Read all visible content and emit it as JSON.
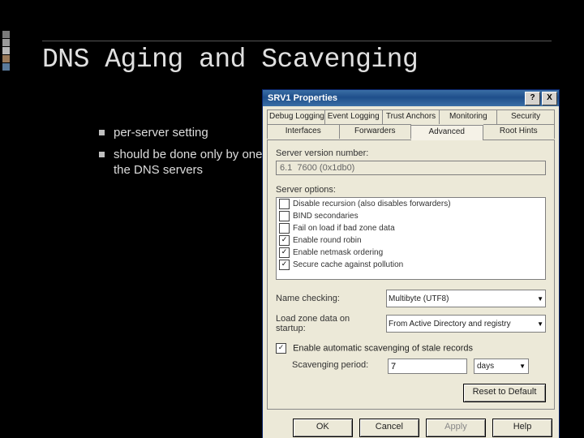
{
  "slide": {
    "title": "DNS Aging and Scavenging",
    "bullets": [
      "per-server setting",
      "should be done only by one of the DNS servers"
    ]
  },
  "dialog": {
    "title": "SRV1 Properties",
    "help": "?",
    "close": "X",
    "tabs_row1": [
      "Debug Logging",
      "Event Logging",
      "Trust Anchors",
      "Monitoring",
      "Security"
    ],
    "tabs_row2": [
      "Interfaces",
      "Forwarders",
      "Advanced",
      "Root Hints"
    ],
    "active_tab": "Advanced",
    "version_label": "Server version number:",
    "version_value": "6.1  7600 (0x1db0)",
    "options_label": "Server options:",
    "options": [
      {
        "checked": false,
        "label": "Disable recursion (also disables forwarders)"
      },
      {
        "checked": false,
        "label": "BIND secondaries"
      },
      {
        "checked": false,
        "label": "Fail on load if bad zone data"
      },
      {
        "checked": true,
        "label": "Enable round robin"
      },
      {
        "checked": true,
        "label": "Enable netmask ordering"
      },
      {
        "checked": true,
        "label": "Secure cache against pollution"
      }
    ],
    "name_checking_label": "Name checking:",
    "name_checking_value": "Multibyte (UTF8)",
    "load_zone_label": "Load zone data on startup:",
    "load_zone_value": "From Active Directory and registry",
    "scavenge_check_label": "Enable automatic scavenging of stale records",
    "scavenge_checked": true,
    "scavenge_period_label": "Scavenging period:",
    "scavenge_period_value": "7",
    "scavenge_unit": "days",
    "reset_button": "Reset to Default",
    "ok": "OK",
    "cancel": "Cancel",
    "apply": "Apply",
    "help_btn": "Help"
  }
}
